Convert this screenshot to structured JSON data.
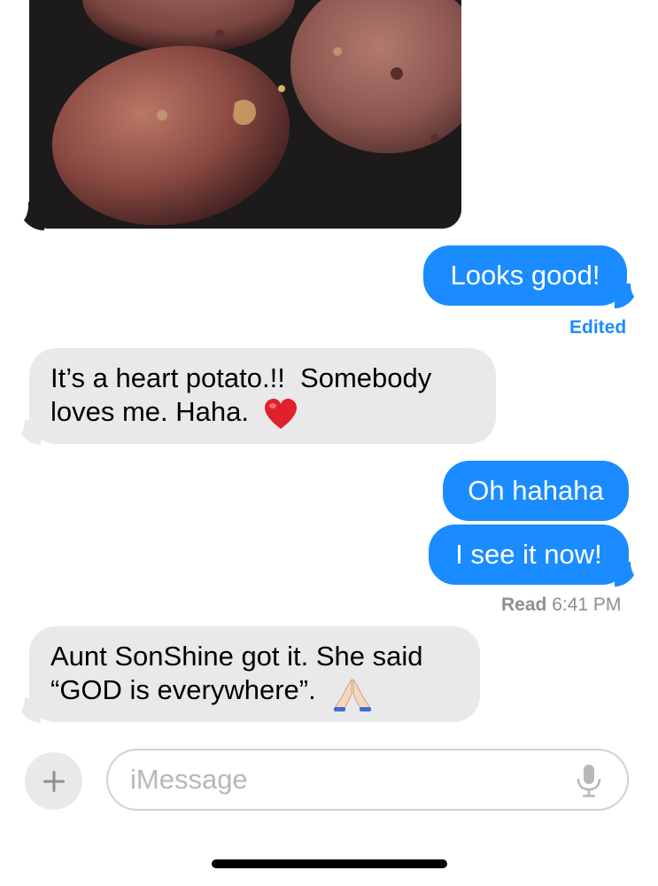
{
  "conversation": {
    "photo": {
      "icon": "potato-photo"
    },
    "messages": [
      {
        "id": "m1",
        "direction": "sent",
        "text": "Looks good!"
      },
      {
        "id": "m2",
        "direction": "received",
        "text": "It’s a heart potato.!!  Somebody\nloves me. Haha."
      },
      {
        "id": "m3",
        "direction": "sent",
        "text": "Oh hahaha"
      },
      {
        "id": "m4",
        "direction": "sent",
        "text": "I see it now!"
      },
      {
        "id": "m5",
        "direction": "received",
        "text": "Aunt SonShine got it. She said\n“GOD is everywhere”."
      }
    ],
    "edited_label": "Edited",
    "read_receipt": {
      "label": "Read",
      "time": "6:41 PM"
    }
  },
  "emoji": {
    "heart": "heart-emoji",
    "praying_hands": "praying-hands-emoji"
  },
  "input_bar": {
    "plus_icon": "plus-icon",
    "placeholder": "iMessage",
    "mic_icon": "microphone-icon"
  },
  "colors": {
    "sent_bubble": "#1a8cff",
    "received_bubble": "#e9e9eb",
    "accent": "#1a8cff"
  }
}
